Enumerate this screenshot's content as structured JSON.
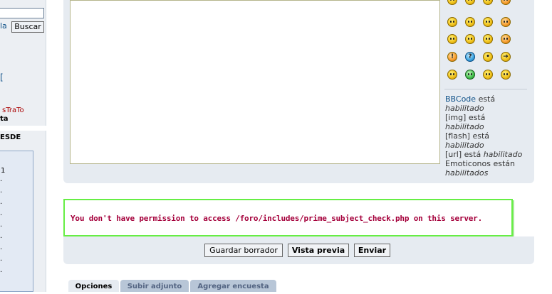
{
  "sidebar": {
    "search_lang_fragment": "la",
    "search_button": "Buscar",
    "bracket_fragment": "[",
    "user_name_fragment": "sTraTo",
    "user_role_fragment": "ta",
    "section_title_fragment": "ESDE",
    "counter_first": "1"
  },
  "smilies": [
    "yellow",
    "yellow",
    "yellow",
    "orange",
    "yellow",
    "yellow",
    "yellow",
    "orange",
    "yellow",
    "yellow",
    "yellow",
    "orange",
    "warning",
    "question",
    "idea",
    "arrow",
    "yellow",
    "green",
    "yellow-glasses",
    "yellow-glasses"
  ],
  "editor_info": {
    "bbcode_link": "BBCode",
    "bbcode_status": "está",
    "bbcode_state": "habilitado",
    "img_label": "[img] está",
    "img_state": "habilitado",
    "flash_label": "[flash] está",
    "flash_state": "habilitado",
    "url_label": "[url] está",
    "url_state": "habilitado",
    "emoticons_label": "Emoticonos están",
    "emoticons_state": "habilitados"
  },
  "error_message": "You don't have permission to access /foro/includes/prime_subject_check.php on this server.",
  "actions": {
    "draft": "Guardar borrador",
    "preview": "Vista previa",
    "send": "Enviar"
  },
  "tabs": [
    "Opciones",
    "Subir adjunto",
    "Agregar encuesta"
  ],
  "colors": {
    "error_text": "#a5003b",
    "error_border": "#66ee44",
    "panel_bg": "#e6ebf1",
    "link": "#105289"
  }
}
